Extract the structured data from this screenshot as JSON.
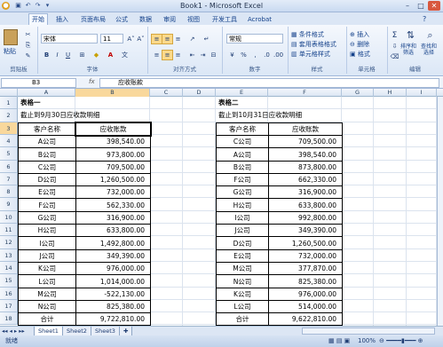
{
  "window": {
    "title": "Book1 - Microsoft Excel",
    "min": "–",
    "max": "□",
    "close": "✕"
  },
  "tabs": [
    "开始",
    "插入",
    "页面布局",
    "公式",
    "数据",
    "审阅",
    "视图",
    "开发工具",
    "Acrobat"
  ],
  "ribbon": {
    "clipboard": {
      "label": "剪贴板",
      "paste": "粘贴"
    },
    "font": {
      "label": "字体",
      "name": "宋体",
      "size": "11",
      "bold": "B",
      "italic": "I",
      "underline": "U",
      "grow": "A˄",
      "shrink": "A˅"
    },
    "alignment": {
      "label": "对齐方式"
    },
    "number": {
      "label": "数字",
      "format": "常规",
      "pct": "%",
      "comma": ",",
      "currency": "¥"
    },
    "styles": {
      "label": "样式",
      "cond": "条件格式",
      "table": "套用表格格式",
      "cell": "单元格样式"
    },
    "cells": {
      "label": "单元格",
      "insert": "插入",
      "delete": "删除",
      "format": "格式"
    },
    "editing": {
      "label": "编辑",
      "sum": "Σ",
      "sort": "排序和\n筛选",
      "find": "查找和\n选择"
    }
  },
  "formula_bar": {
    "name_box": "B3",
    "fx": "fx",
    "content": "应收账款"
  },
  "columns": [
    "A",
    "B",
    "C",
    "D",
    "E",
    "F",
    "G",
    "H",
    "I"
  ],
  "rows": [
    "1",
    "2",
    "3",
    "4",
    "5",
    "6",
    "7",
    "8",
    "9",
    "10",
    "11",
    "12",
    "13",
    "14",
    "15",
    "16",
    "17",
    "18"
  ],
  "table1": {
    "title": "表格一",
    "subtitle": "截止到9月30日应收款明细",
    "header": [
      "客户名称",
      "应收账款"
    ],
    "rows": [
      [
        "A公司",
        "398,540.00"
      ],
      [
        "B公司",
        "973,800.00"
      ],
      [
        "C公司",
        "709,500.00"
      ],
      [
        "D公司",
        "1,260,500.00"
      ],
      [
        "E公司",
        "732,000.00"
      ],
      [
        "F公司",
        "562,330.00"
      ],
      [
        "G公司",
        "316,900.00"
      ],
      [
        "H公司",
        "633,800.00"
      ],
      [
        "I公司",
        "1,492,800.00"
      ],
      [
        "J公司",
        "349,390.00"
      ],
      [
        "K公司",
        "976,000.00"
      ],
      [
        "L公司",
        "1,014,000.00"
      ],
      [
        "M公司",
        "-522,130.00"
      ],
      [
        "N公司",
        "825,380.00"
      ]
    ],
    "total": [
      "合计",
      "9,722,810.00"
    ]
  },
  "table2": {
    "title": "表格二",
    "subtitle": "截止到10月31日应收款明细",
    "header": [
      "客户名称",
      "应收账款"
    ],
    "rows": [
      [
        "C公司",
        "709,500.00"
      ],
      [
        "A公司",
        "398,540.00"
      ],
      [
        "B公司",
        "873,800.00"
      ],
      [
        "F公司",
        "662,330.00"
      ],
      [
        "G公司",
        "316,900.00"
      ],
      [
        "H公司",
        "633,800.00"
      ],
      [
        "I公司",
        "992,800.00"
      ],
      [
        "J公司",
        "349,390.00"
      ],
      [
        "D公司",
        "1,260,500.00"
      ],
      [
        "E公司",
        "732,000.00"
      ],
      [
        "M公司",
        "377,870.00"
      ],
      [
        "N公司",
        "825,380.00"
      ],
      [
        "K公司",
        "976,000.00"
      ],
      [
        "L公司",
        "514,000.00"
      ]
    ],
    "total": [
      "合计",
      "9,622,810.00"
    ]
  },
  "sheets": [
    "Sheet1",
    "Sheet2",
    "Sheet3"
  ],
  "status": {
    "ready": "就绪",
    "zoom": "100%"
  }
}
